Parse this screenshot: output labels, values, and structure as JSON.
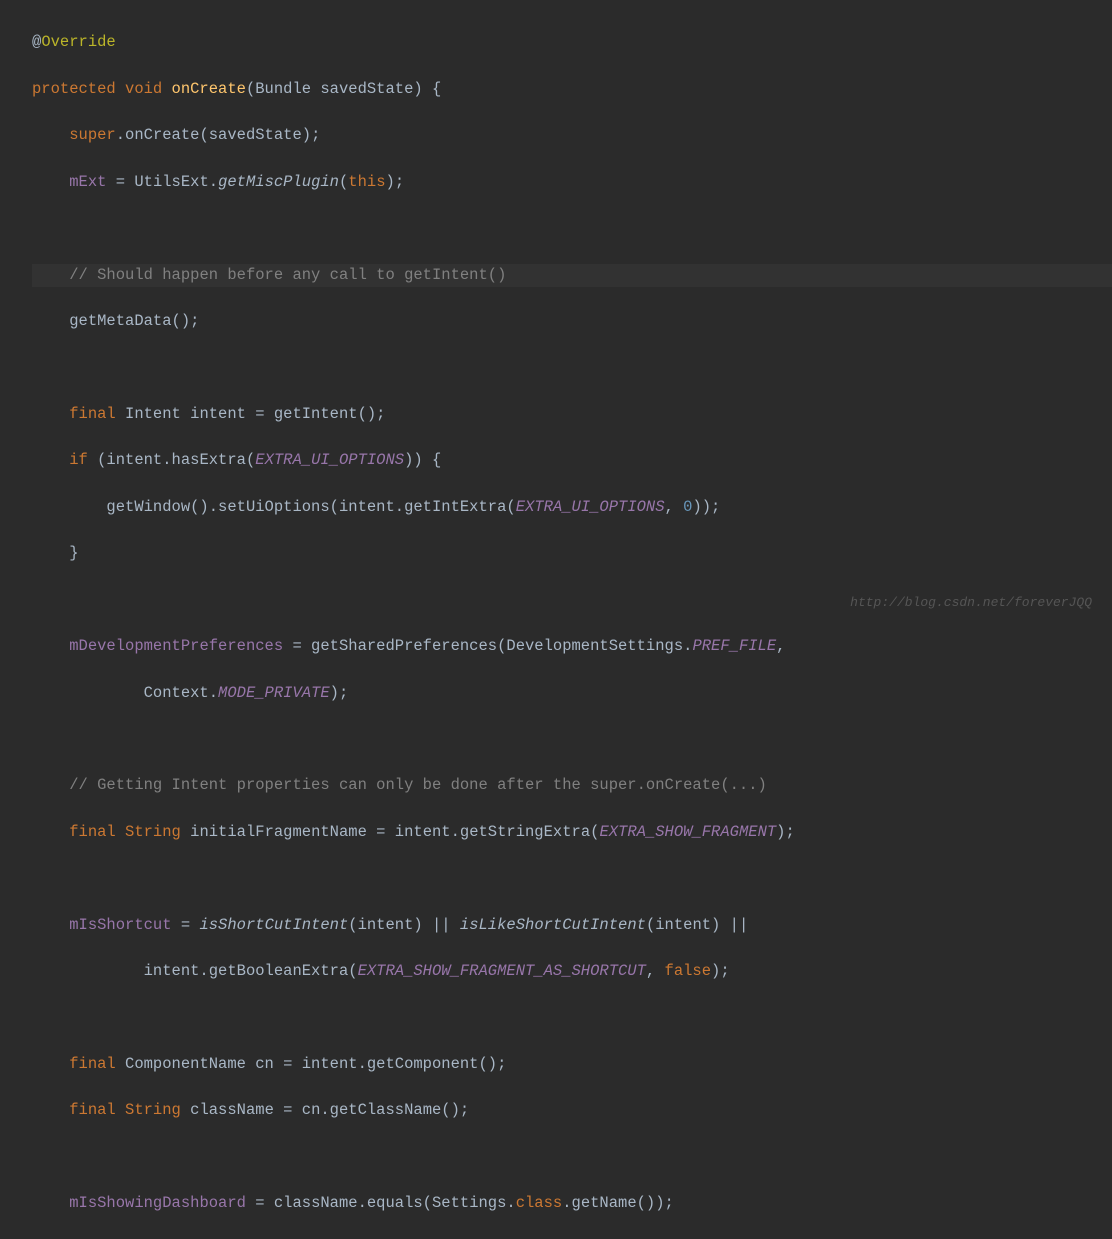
{
  "code": {
    "l1_at": "@",
    "l1_override": "Override",
    "l2_protected": "protected ",
    "l2_void": "void ",
    "l2_method": "onCreate",
    "l2_rest": "(Bundle savedState) {",
    "l3_super": "super",
    "l3_rest": ".onCreate(savedState);",
    "l4_field": "mExt",
    "l4_eq": " = UtilsExt.",
    "l4_static": "getMiscPlugin",
    "l4_this_pre": "(",
    "l4_this": "this",
    "l4_end": ");",
    "l6_comment": "// Should happen before any call to getIntent()",
    "l7": "getMetaData();",
    "l9_final": "final ",
    "l9_rest": "Intent intent = getIntent();",
    "l10_if": "if ",
    "l10_rest1": "(intent.hasExtra(",
    "l10_const": "EXTRA_UI_OPTIONS",
    "l10_rest2": ")) {",
    "l11_rest1": "getWindow().setUiOptions(intent.getIntExtra(",
    "l11_const": "EXTRA_UI_OPTIONS",
    "l11_comma": ", ",
    "l11_num": "0",
    "l11_end": "));",
    "l12": "}",
    "l14_field": "mDevelopmentPreferences",
    "l14_rest1": " = getSharedPreferences(DevelopmentSettings.",
    "l14_const": "PREF_FILE",
    "l14_comma": ",",
    "l15_rest1": "Context.",
    "l15_const": "MODE_PRIVATE",
    "l15_end": ");",
    "l17_comment": "// Getting Intent properties can only be done after the super.onCreate(...)",
    "l18_final": "final ",
    "l18_string": "String ",
    "l18_rest1": "initialFragmentName = intent.getStringExtra(",
    "l18_const": "EXTRA_SHOW_FRAGMENT",
    "l18_end": ");",
    "l20_field": "mIsShortcut",
    "l20_eq": " = ",
    "l20_m1": "isShortCutIntent",
    "l20_rest1": "(intent) || ",
    "l20_m2": "isLikeShortCutIntent",
    "l20_rest2": "(intent) ||",
    "l21_rest1": "intent.getBooleanExtra(",
    "l21_const": "EXTRA_SHOW_FRAGMENT_AS_SHORTCUT",
    "l21_comma": ", ",
    "l21_false": "false",
    "l21_end": ");",
    "l23_final": "final ",
    "l23_rest": "ComponentName cn = intent.getComponent();",
    "l24_final": "final ",
    "l24_string": "String ",
    "l24_rest": "className = cn.getClassName();",
    "l26_field": "mIsShowingDashboard",
    "l26_rest1": " = className.equals(Settings.",
    "l26_class": "class",
    "l26_rest2": ".getName());"
  },
  "watermark": "http://blog.csdn.net/foreverJQQ"
}
